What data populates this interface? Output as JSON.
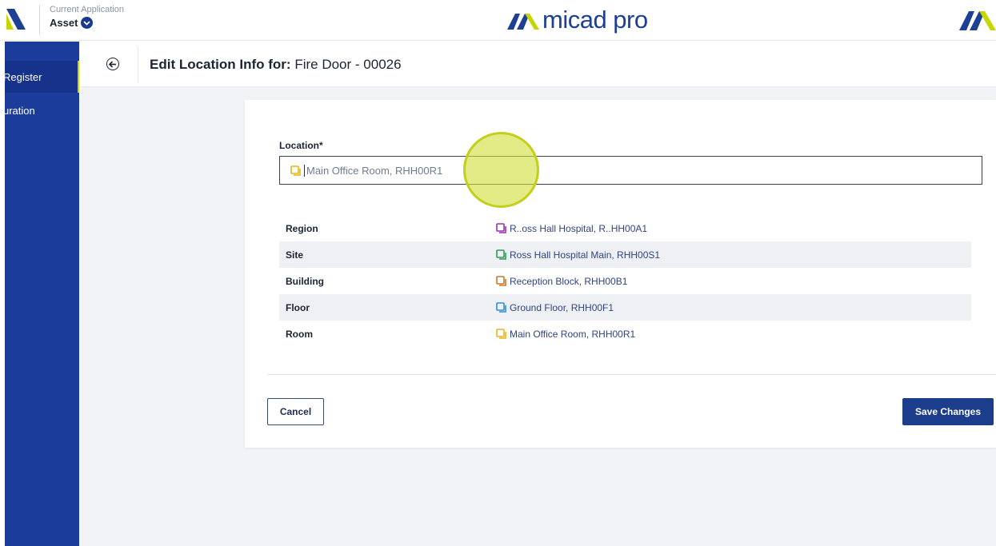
{
  "header": {
    "app_caption": "Current Application",
    "app_name": "Asset",
    "brand_name": "micad pro",
    "brand_color": "#1d3f94",
    "accent_color": "#c6d600"
  },
  "sidebar": {
    "items": [
      {
        "label": "Register",
        "active": true
      },
      {
        "label": "uration",
        "active": false
      }
    ],
    "color": "#1c3c9c"
  },
  "page": {
    "title_prefix": "Edit Location Info for:",
    "title_subject": "Fire Door - 00026"
  },
  "form": {
    "location_label": "Location*",
    "location_value": "Main Office Room, RHH00R1",
    "location_icon": "room-icon",
    "hierarchy": [
      {
        "label": "Region",
        "value": "R..oss Hall Hospital, R..HH00A1",
        "icon_color": "#9b2fae"
      },
      {
        "label": "Site",
        "value": "Ross Hall Hospital Main, RHH00S1",
        "icon_color": "#2e9b5a"
      },
      {
        "label": "Building",
        "value": "Reception Block, RHH00B1",
        "icon_color": "#c8782a"
      },
      {
        "label": "Floor",
        "value": "Ground Floor, RHH00F1",
        "icon_color": "#2f8fd6"
      },
      {
        "label": "Room",
        "value": "Main Office Room, RHH00R1",
        "icon_color": "#e6b417"
      }
    ]
  },
  "actions": {
    "cancel_label": "Cancel",
    "save_label": "Save Changes"
  }
}
